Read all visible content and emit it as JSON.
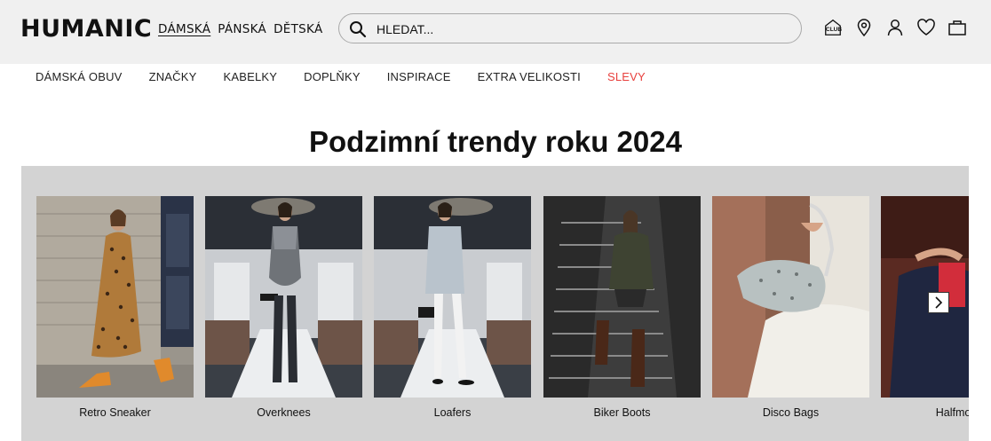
{
  "header": {
    "logo": "HUMANIC",
    "gender_tabs": [
      {
        "label": "DÁMSKÁ",
        "active": true
      },
      {
        "label": "PÁNSKÁ",
        "active": false
      },
      {
        "label": "DĚTSKÁ",
        "active": false
      }
    ],
    "search": {
      "placeholder": "HLEDAT...",
      "value": "",
      "icon": "search-icon"
    },
    "icons": {
      "club_label": "CLUB",
      "items": [
        "club-icon",
        "store-locator-icon",
        "account-icon",
        "wishlist-icon",
        "cart-icon"
      ]
    }
  },
  "category_nav": {
    "items": [
      {
        "label": "DÁMSKÁ OBUV"
      },
      {
        "label": "ZNAČKY"
      },
      {
        "label": "KABELKY"
      },
      {
        "label": "DOPLŇKY"
      },
      {
        "label": "INSPIRACE"
      },
      {
        "label": "EXTRA VELIKOSTI"
      },
      {
        "label": "SLEVY",
        "highlight": true
      }
    ],
    "sale_color": "#e8403d"
  },
  "main": {
    "title": "Podzimní trendy roku 2024",
    "carousel": {
      "cards": [
        {
          "caption": "Retro Sneaker"
        },
        {
          "caption": "Overknees"
        },
        {
          "caption": "Loafers"
        },
        {
          "caption": "Biker Boots"
        },
        {
          "caption": "Disco Bags"
        },
        {
          "caption": "Halfmoon"
        }
      ],
      "next_icon": "chevron-right-icon",
      "background": "#d3d3d3"
    }
  }
}
